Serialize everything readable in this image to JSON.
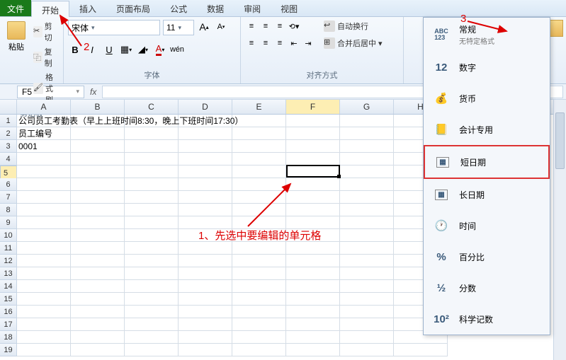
{
  "menu": {
    "file": "文件",
    "tabs": [
      "开始",
      "插入",
      "页面布局",
      "公式",
      "数据",
      "审阅",
      "视图"
    ],
    "active_index": 0
  },
  "ribbon": {
    "clipboard": {
      "label": "剪贴板",
      "paste": "粘贴",
      "cut": "剪切",
      "copy": "复制",
      "brush": "格式刷"
    },
    "font": {
      "label": "字体",
      "name": "宋体",
      "size": "11",
      "bold": "B",
      "italic": "I",
      "underline": "U"
    },
    "align": {
      "label": "对齐方式",
      "wrap": "自动换行",
      "merge": "合并后居中"
    },
    "number_trigger_selected": ""
  },
  "namebox": "F5",
  "columns": [
    "A",
    "B",
    "C",
    "D",
    "E",
    "F",
    "G",
    "H"
  ],
  "rowcount": 19,
  "cells": {
    "r1c1": "公司员工考勤表（早上上班时间8:30，晚上下班时间17:30）",
    "r2c1": "员工编号",
    "r3c1": "0001"
  },
  "selected": {
    "row": 5,
    "col": 6
  },
  "number_formats": [
    {
      "icon": "ABC123",
      "label": "常规",
      "sub": "无特定格式"
    },
    {
      "icon": "12",
      "label": "数字"
    },
    {
      "icon": "coins",
      "label": "货币"
    },
    {
      "icon": "ledger",
      "label": "会计专用"
    },
    {
      "icon": "cal",
      "label": "短日期",
      "highlight": true
    },
    {
      "icon": "cal",
      "label": "长日期"
    },
    {
      "icon": "clock",
      "label": "时间"
    },
    {
      "icon": "%",
      "label": "百分比"
    },
    {
      "icon": "½",
      "label": "分数"
    },
    {
      "icon": "10²",
      "label": "科学记数"
    }
  ],
  "annotations": {
    "n2": "2",
    "n3": "3",
    "n1": "1、先选中要编辑的单元格"
  }
}
